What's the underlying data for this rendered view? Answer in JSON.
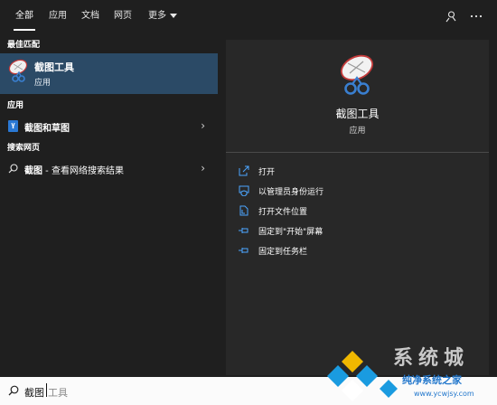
{
  "tabs": [
    {
      "label": "全部",
      "active": true
    },
    {
      "label": "应用"
    },
    {
      "label": "文档"
    },
    {
      "label": "网页"
    },
    {
      "label": "更多"
    }
  ],
  "top_icons": [
    "feedback-icon",
    "more-options-icon"
  ],
  "left": {
    "best_match_header": "最佳匹配",
    "best_match": {
      "title": "截图工具",
      "subtitle": "应用",
      "icon": "snipping-tool-icon"
    },
    "apps_header": "应用",
    "apps": [
      {
        "label": "截图和草图",
        "icon": "snip-sketch-icon"
      }
    ],
    "web_header": "搜索网页",
    "web": [
      {
        "bold": "截图",
        "rest": " - 查看网络搜索结果",
        "icon": "search-icon"
      }
    ]
  },
  "right": {
    "title": "截图工具",
    "subtitle": "应用",
    "actions": [
      {
        "label": "打开",
        "icon": "open-icon"
      },
      {
        "label": "以管理员身份运行",
        "icon": "admin-shield-icon"
      },
      {
        "label": "打开文件位置",
        "icon": "file-location-icon"
      },
      {
        "label": "固定到\"开始\"屏幕",
        "icon": "pin-icon"
      },
      {
        "label": "固定到任务栏",
        "icon": "pin-icon"
      }
    ]
  },
  "search": {
    "typed": "截图",
    "suggestion": "工具"
  },
  "watermark": {
    "line1": "系统城",
    "line2": "纯净系统之家",
    "line3": "www.ycwjsy.com"
  },
  "colors": {
    "background": "#1f1f1f",
    "selected": "#2b4a66",
    "detail_pane": "#282828",
    "accent": "#4ca6ff"
  }
}
